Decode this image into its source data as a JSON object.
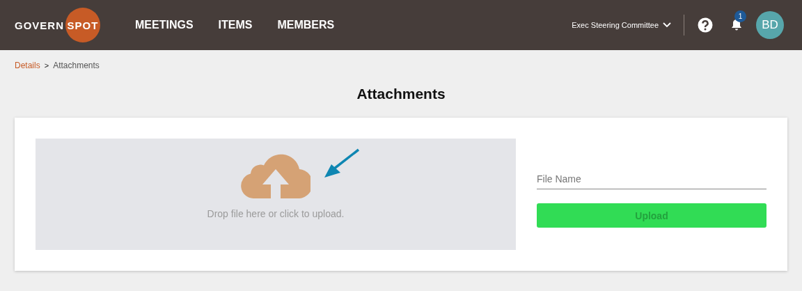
{
  "header": {
    "logo": {
      "left": "GOVERN",
      "right": "SPOT"
    },
    "nav": [
      {
        "label": "MEETINGS",
        "selected": false
      },
      {
        "label": "ITEMS",
        "selected": false
      },
      {
        "label": "MEMBERS",
        "selected": false
      }
    ],
    "committee": "Exec Steering Committee",
    "notifications": "1",
    "avatar": "BD"
  },
  "breadcrumb": [
    {
      "label": "Details",
      "kind": "link"
    },
    {
      "label": "Attachments",
      "kind": "current"
    }
  ],
  "breadcrumb_separator": ">",
  "title": "Attachments",
  "dropzone": {
    "text": "Drop file here or click to upload."
  },
  "file_name": {
    "placeholder": "File Name"
  },
  "upload_button": {
    "label": "Upload",
    "disabled": true
  }
}
